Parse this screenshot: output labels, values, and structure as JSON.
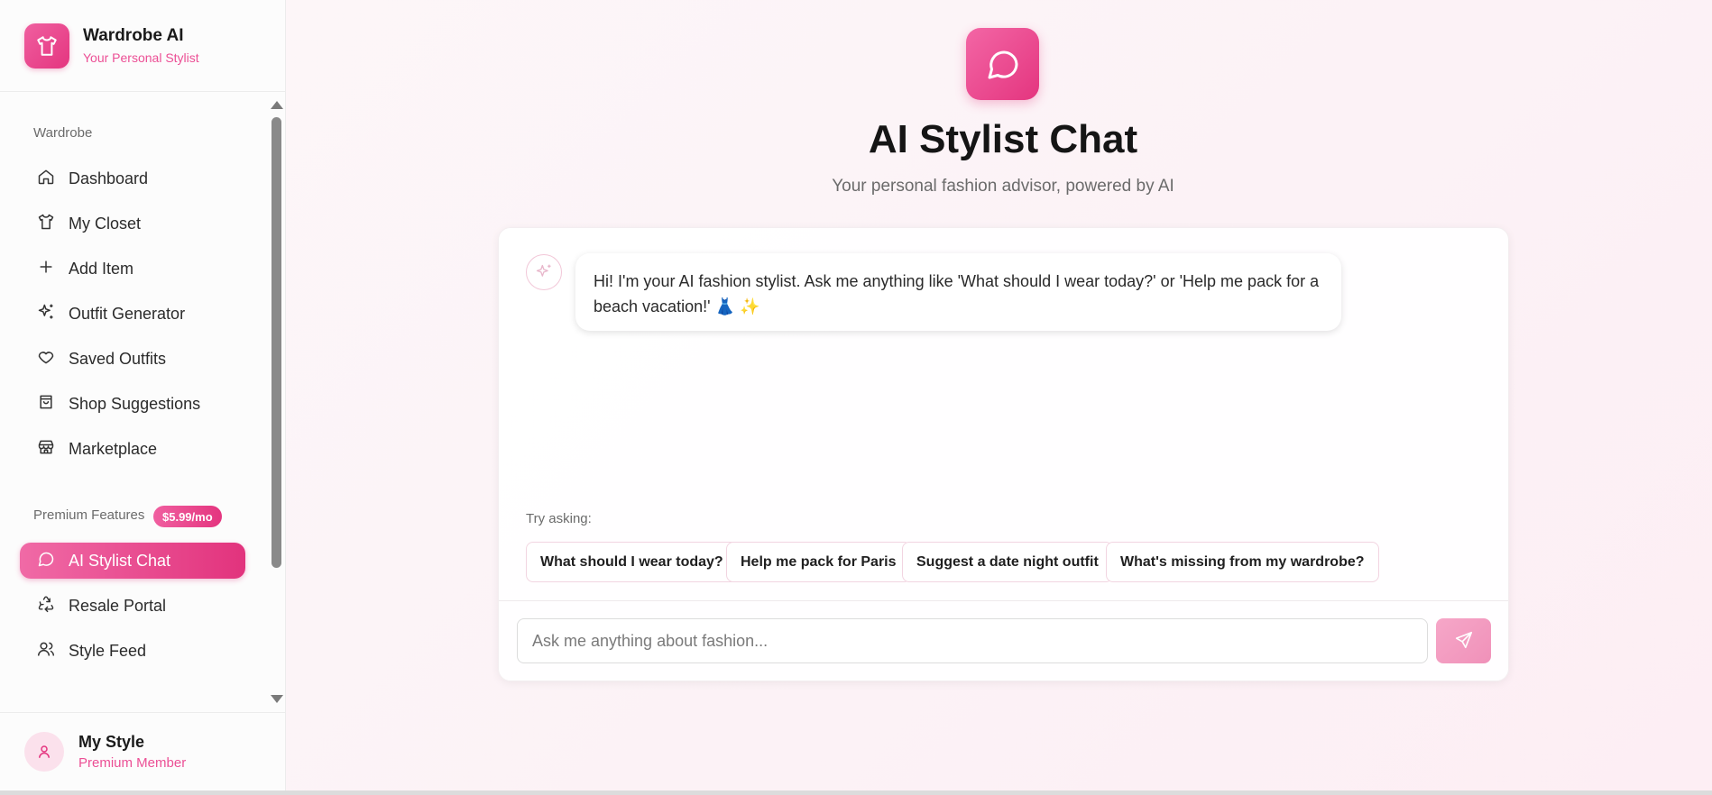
{
  "brand": {
    "title": "Wardrobe AI",
    "subtitle": "Your Personal Stylist"
  },
  "sidebar": {
    "sections": [
      {
        "label": "Wardrobe"
      },
      {
        "label": "Premium Features",
        "badge": "$5.99/mo"
      }
    ],
    "items": [
      {
        "label": "Dashboard",
        "icon": "home-icon"
      },
      {
        "label": "My Closet",
        "icon": "shirt-icon"
      },
      {
        "label": "Add Item",
        "icon": "plus-icon"
      },
      {
        "label": "Outfit Generator",
        "icon": "sparkles-icon"
      },
      {
        "label": "Saved Outfits",
        "icon": "heart-icon"
      },
      {
        "label": "Shop Suggestions",
        "icon": "shopping-bag-icon"
      },
      {
        "label": "Marketplace",
        "icon": "store-icon"
      },
      {
        "label": "AI Stylist Chat",
        "icon": "chat-icon",
        "active": true
      },
      {
        "label": "Resale Portal",
        "icon": "recycle-icon"
      },
      {
        "label": "Style Feed",
        "icon": "users-icon"
      }
    ]
  },
  "profile": {
    "name": "My Style",
    "subtitle": "Premium Member"
  },
  "main": {
    "title": "AI Stylist Chat",
    "subtitle": "Your personal fashion advisor, powered by AI",
    "messages": [
      {
        "from": "bot",
        "text": "Hi! I'm your AI fashion stylist. Ask me anything like 'What should I wear today?' or 'Help me pack for a beach vacation!' 👗 ✨"
      }
    ],
    "try_label": "Try asking:",
    "suggestions": [
      "What should I wear today?",
      "Help me pack for Paris",
      "Suggest a date night outfit",
      "What's missing from my wardrobe?"
    ],
    "input_placeholder": "Ask me anything about fashion..."
  },
  "colors": {
    "accent": "#e4357f",
    "accent_light": "#f06aa6",
    "subtle_pink": "#ec4f95"
  }
}
